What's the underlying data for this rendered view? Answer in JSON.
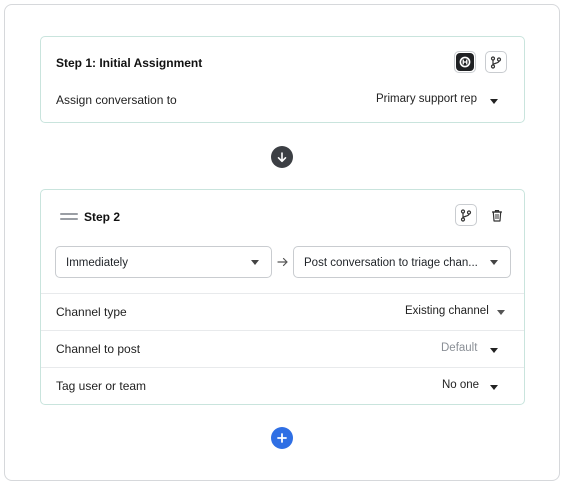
{
  "step1": {
    "title": "Step 1: Initial Assignment",
    "assign_label": "Assign conversation to",
    "assign_value": "Primary support rep"
  },
  "step2": {
    "title": "Step 2",
    "timing_select": "Immediately",
    "action_select": "Post conversation to triage chan...",
    "rows": [
      {
        "label": "Channel type",
        "value": "Existing channel"
      },
      {
        "label": "Channel to post",
        "value": "Default"
      },
      {
        "label": "Tag user or team",
        "value": "No one"
      }
    ]
  },
  "colors": {
    "card_border": "#c9e4dd",
    "add_button": "#2f6fe4",
    "connector_arrow": "#3c3f44",
    "muted_text": "#8a8f96"
  },
  "icons": {
    "step1_logo": "app-logo-icon",
    "branch": "branch-icon",
    "delete": "trash-icon",
    "drag": "drag-handle-icon",
    "connector": "arrow-down-icon",
    "add": "plus-icon",
    "flow": "arrow-right-icon"
  }
}
